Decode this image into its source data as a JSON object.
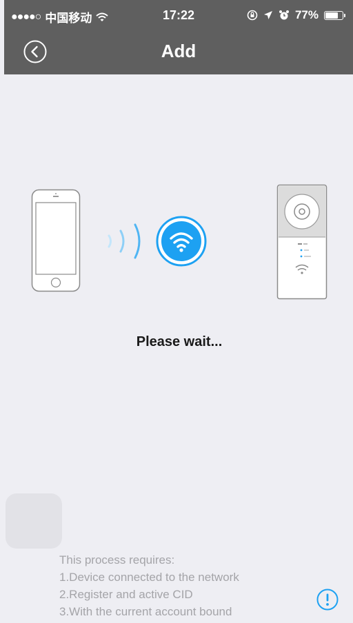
{
  "status_bar": {
    "carrier": "中国移动",
    "time": "17:22",
    "battery": "77%",
    "battery_level": 0.77
  },
  "nav": {
    "title": "Add",
    "back_icon": "back-circle-icon"
  },
  "illustration": {
    "phone_icon": "smartphone-icon",
    "waves_icon": "signal-waves-icon",
    "wifi_icon": "wifi-icon",
    "device_icon": "camera-device-icon"
  },
  "message": "Please wait...",
  "notes": {
    "heading": "This process requires:",
    "items": [
      "1.Device connected to the network",
      "2.Register and active CID",
      "3.With the current account bound"
    ]
  },
  "colors": {
    "accent": "#1da1f2",
    "header": "#5f5f5f",
    "background": "#eeeef3"
  }
}
